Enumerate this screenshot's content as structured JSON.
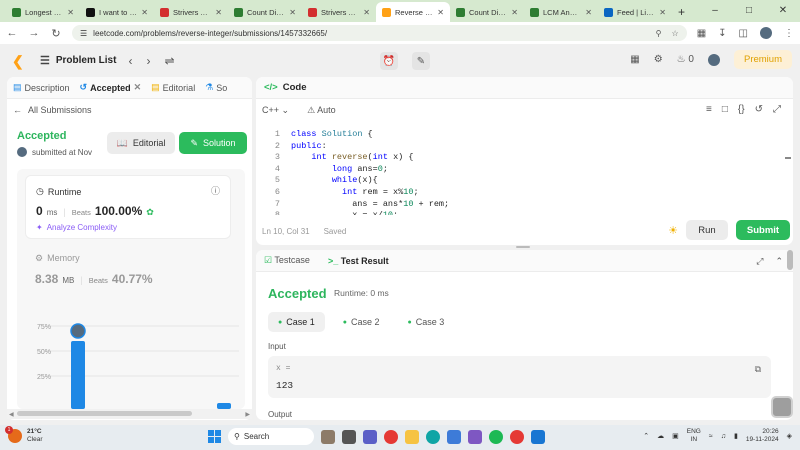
{
  "browser": {
    "tabs": [
      {
        "title": "Longest Nice Subarray",
        "fav": "#2e7d32",
        "active": false
      },
      {
        "title": "I want to write",
        "fav": "#111111",
        "active": false
      },
      {
        "title": "Strivers A2Z DSA",
        "fav": "#d32f2f",
        "active": false
      },
      {
        "title": "Count Digits",
        "fav": "#2e7d32",
        "active": false
      },
      {
        "title": "Strivers A2Z DSA",
        "fav": "#d32f2f",
        "active": false
      },
      {
        "title": "Reverse Integer",
        "fav": "#ffa116",
        "active": true
      },
      {
        "title": "Count Digits",
        "fav": "#2e7d32",
        "active": false
      },
      {
        "title": "LCM And GCD",
        "fav": "#2e7d32",
        "active": false
      },
      {
        "title": "Feed | LinkedIn",
        "fav": "#0a66c2",
        "active": false
      }
    ],
    "url": "leetcode.com/problems/reverse-integer/submissions/1457332665/"
  },
  "lc": {
    "problem_list": "Problem List",
    "premium": "Premium",
    "fire_count": "0"
  },
  "left": {
    "tabs": {
      "description": "Description",
      "accepted": "Accepted",
      "editorial": "Editorial",
      "solutions": "So"
    },
    "all_submissions": "All Submissions",
    "status": "Accepted",
    "submitted": "submitted at Nov",
    "editorial_btn": "Editorial",
    "solution_btn": "Solution",
    "runtime": {
      "label": "Runtime",
      "value": "0",
      "unit": "ms",
      "beats_label": "Beats",
      "beats": "100.00%",
      "analyze": "Analyze Complexity"
    },
    "memory": {
      "label": "Memory",
      "value": "8.38",
      "unit": "MB",
      "beats_label": "Beats",
      "beats": "40.77%"
    }
  },
  "chart_data": {
    "type": "bar",
    "yticks": [
      "75%",
      "50%",
      "25%"
    ],
    "ylim": [
      0,
      90
    ]
  },
  "code": {
    "title": "Code",
    "lang": "C++",
    "mode": "Auto",
    "lines": [
      {
        "n": "1",
        "t": "class Solution {"
      },
      {
        "n": "2",
        "t": "public:"
      },
      {
        "n": "3",
        "t": "    int reverse(int x) {"
      },
      {
        "n": "4",
        "t": "        long ans=0;"
      },
      {
        "n": "5",
        "t": "        while(x){"
      },
      {
        "n": "6",
        "t": "          int rem = x%10;"
      },
      {
        "n": "7",
        "t": "            ans = ans*10 + rem;"
      },
      {
        "n": "8",
        "t": "            x = x/10;"
      }
    ],
    "position": "Ln 10, Col 31",
    "saved": "Saved",
    "run": "Run",
    "submit": "Submit"
  },
  "result": {
    "testcase_tab": "Testcase",
    "result_tab": "Test Result",
    "status": "Accepted",
    "runtime": "Runtime: 0 ms",
    "cases": [
      "Case 1",
      "Case 2",
      "Case 3"
    ],
    "input_label": "Input",
    "var": "x =",
    "value": "123",
    "output_label": "Output"
  },
  "taskbar": {
    "temp": "21°C",
    "cond": "Clear",
    "badge": "1",
    "search": "Search",
    "lang1": "ENG",
    "lang2": "IN",
    "time": "20:26",
    "date": "19-11-2024"
  }
}
